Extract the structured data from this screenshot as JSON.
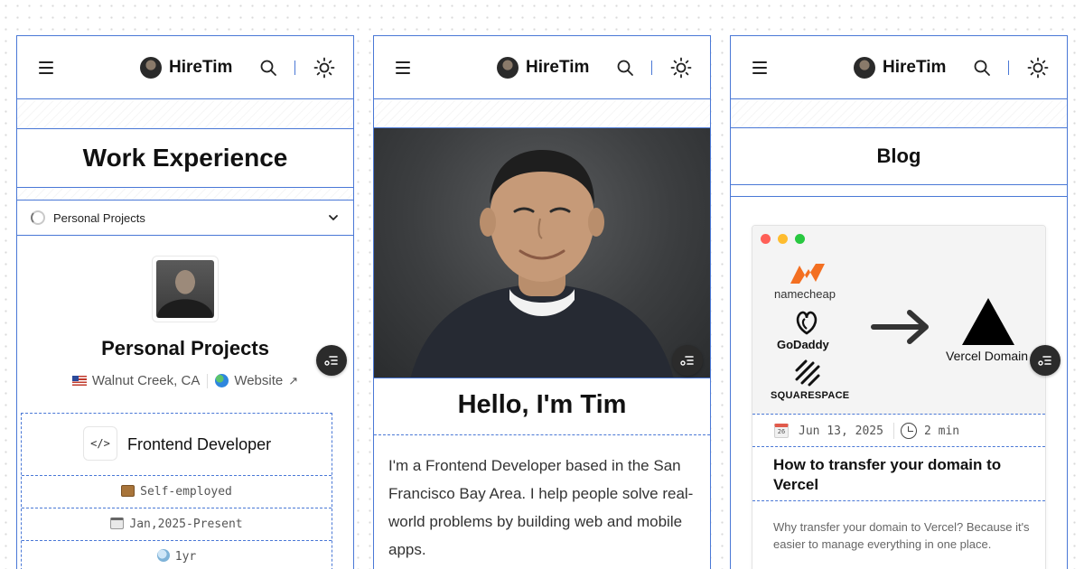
{
  "brand": {
    "name": "HireTim"
  },
  "colors": {
    "accent": "#4a78d6",
    "fab": "#2b2b2b",
    "mac_red": "#ff5f57",
    "mac_yellow": "#febc2e",
    "mac_green": "#28c840",
    "namecheap": "#f36f21"
  },
  "icons": [
    "menu-icon",
    "avatar",
    "search-icon",
    "sun-icon",
    "spinner-icon",
    "chevron-down-icon",
    "flag-icon",
    "globe-icon",
    "arrow-up-right-icon",
    "code-icon",
    "briefcase-icon",
    "calendar-icon",
    "clock-icon",
    "toc-icon",
    "arrow-right-icon"
  ],
  "panel1": {
    "title": "Work Experience",
    "select": {
      "value": "Personal Projects"
    },
    "project": {
      "name": "Personal Projects",
      "location": "Walnut Creek, CA",
      "website_label": "Website",
      "arrow": "↗"
    },
    "role": {
      "icon": "</>",
      "title": "Frontend Developer",
      "employment": "Self-employed",
      "period": "Jan,2025-Present",
      "duration": "1yr"
    }
  },
  "panel2": {
    "heading": "Hello, I'm Tim",
    "bio": "I'm a Frontend Developer based in the San Francisco Bay Area. I help people solve real-world problems by building web and mobile apps."
  },
  "panel3": {
    "title": "Blog",
    "post": {
      "hero": {
        "namecheap": "namecheap",
        "godaddy": "GoDaddy",
        "squarespace": "SQUARESPACE",
        "vercel": "Vercel Domain"
      },
      "calendar_day": "26",
      "date": "Jun 13, 2025",
      "read_time": "2 min",
      "title": "How to transfer your domain to Vercel",
      "excerpt": "Why transfer your domain to Vercel? Because it's easier to manage everything in one place."
    }
  }
}
